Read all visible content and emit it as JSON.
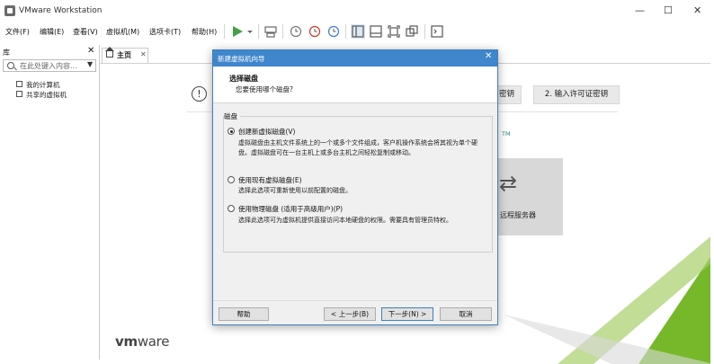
{
  "window": {
    "title": "VMware Workstation",
    "minimize": "—",
    "maximize": "☐",
    "close": "✕"
  },
  "menu": {
    "items": [
      "文件(F)",
      "编辑(E)",
      "查看(V)",
      "虚拟机(M)",
      "选项卡(T)",
      "帮助(H)"
    ]
  },
  "toolbar": {
    "icons": [
      "play-icon",
      "dropdown-arrow-icon",
      "send-keys-icon",
      "snapshot-icon",
      "revert-snapshot-icon",
      "snapshot-manager-icon",
      "sidebar-view-icon",
      "thumbnail-view-icon",
      "fullscreen-icon",
      "unity-icon",
      "console-icon"
    ],
    "play_color": "#43a047"
  },
  "library": {
    "label": "库",
    "close": "✕",
    "search_placeholder": "在此处键入内容...",
    "items": [
      {
        "label": "我的计算机"
      },
      {
        "label": "共享的虚拟机"
      }
    ]
  },
  "tabs": {
    "home_label": "主页",
    "home_close": "✕"
  },
  "home": {
    "info_icon": "!",
    "partial_button": "密钥",
    "enter_key_button": "2. 输入许可证密钥",
    "tm": "TM",
    "remote_label": "远程服务器",
    "remote_icon": "⇄",
    "logo_vm": "vm",
    "logo_ware": "ware"
  },
  "dialog": {
    "title": "新建虚拟机向导",
    "close": "✕",
    "heading": "选择磁盘",
    "subheading": "您要使用哪个磁盘?",
    "group_label": "磁盘",
    "options": [
      {
        "label": "创建新虚拟磁盘(V)",
        "checked": true,
        "desc": "虚拟磁盘由主机文件系统上的一个或多个文件组成，客户机操作系统会将其视为单个硬盘。虚拟磁盘可在一台主机上或多台主机之间轻松复制或移动。"
      },
      {
        "label": "使用现有虚拟磁盘(E)",
        "checked": false,
        "desc": "选择此选项可重新使用以前配置的磁盘。"
      },
      {
        "label": "使用物理磁盘 (适用于高级用户)(P)",
        "checked": false,
        "desc": "选择此选项可为虚拟机提供直接访问本地硬盘的权限。需要具有管理员特权。"
      }
    ],
    "buttons": {
      "help": "帮助",
      "back": "< 上一步(B)",
      "next": "下一步(N) >",
      "cancel": "取消"
    }
  },
  "colors": {
    "dialog_title_bar": "#3f86cc",
    "brand_green": "#76b82a",
    "teal_accent": "#2b8a86"
  }
}
